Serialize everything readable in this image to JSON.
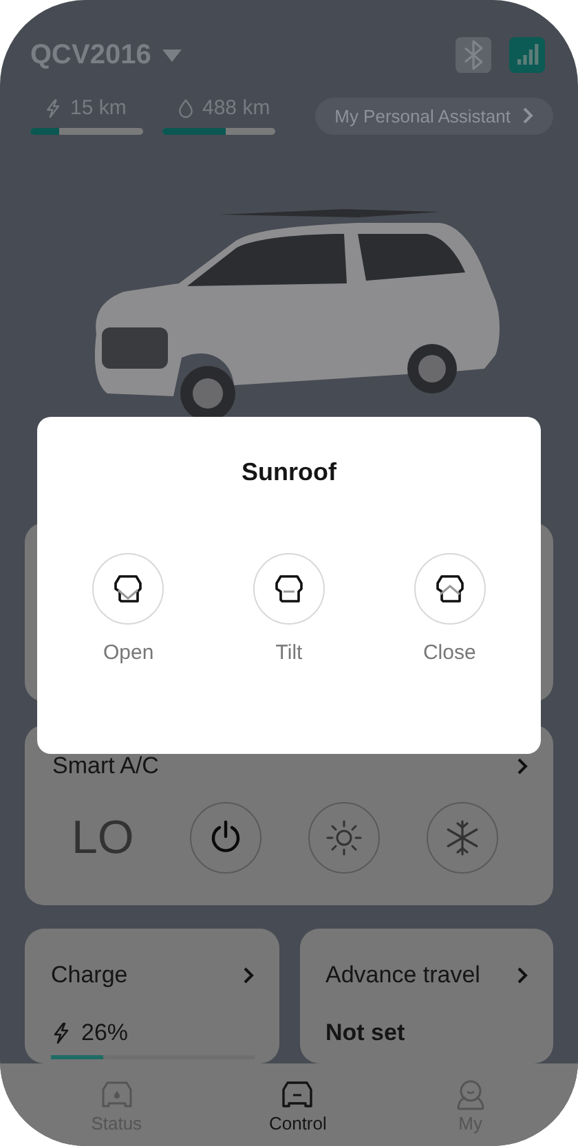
{
  "header": {
    "vehicle": "QCV2016",
    "bluetooth_active": false,
    "signal_active": true
  },
  "ranges": [
    {
      "kind": "electric",
      "reading": "15 km",
      "level": 0.26
    },
    {
      "kind": "fuel",
      "reading": "488 km",
      "level": 0.56
    }
  ],
  "assistant": {
    "label": "My Personal Assistant"
  },
  "ac": {
    "title": "Smart A/C",
    "temperature": "LO",
    "controls": [
      {
        "kind": "power"
      },
      {
        "kind": "heat"
      },
      {
        "kind": "cool"
      }
    ]
  },
  "charge": {
    "title": "Charge",
    "reading": "26%",
    "level": 0.26
  },
  "travel": {
    "title": "Advance travel",
    "value": "Not set"
  },
  "tabs": [
    {
      "kind": "status",
      "label": "Status",
      "selected": false
    },
    {
      "kind": "control",
      "label": "Control",
      "selected": true
    },
    {
      "kind": "my",
      "label": "My",
      "selected": false
    }
  ],
  "dialog": {
    "title": "Sunroof",
    "actions": [
      {
        "kind": "open",
        "label": "Open"
      },
      {
        "kind": "tilt",
        "label": "Tilt"
      },
      {
        "kind": "close",
        "label": "Close"
      }
    ]
  }
}
